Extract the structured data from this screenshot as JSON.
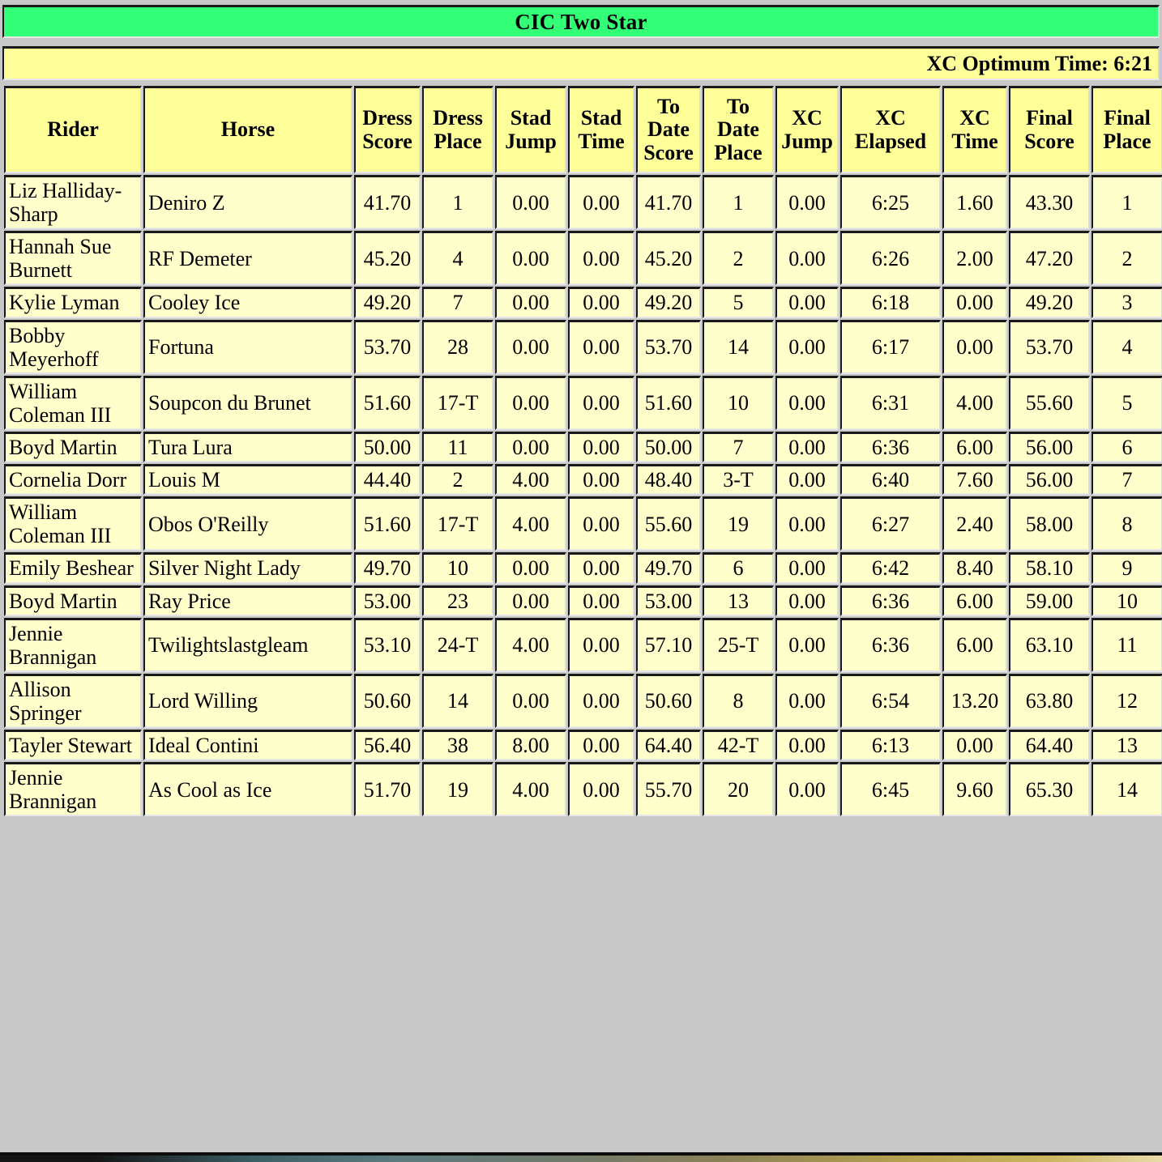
{
  "header": {
    "title": "CIC Two Star",
    "optimum_time_label": "XC Optimum Time: 6:21",
    "colors": {
      "title_bar_bg": "#33FF77",
      "optimum_bar_bg": "#FFFF99",
      "table_header_bg": "#FFFF99",
      "table_cell_bg": "#FFFFCC",
      "border_dark": "#1A1A1A",
      "page_bg": "#C8C8C8"
    }
  },
  "table": {
    "columns": [
      {
        "key": "rider",
        "label": "Rider"
      },
      {
        "key": "horse",
        "label": "Horse"
      },
      {
        "key": "dress_score",
        "label": "Dress Score"
      },
      {
        "key": "dress_place",
        "label": "Dress Place"
      },
      {
        "key": "stad_jump",
        "label": "Stad Jump"
      },
      {
        "key": "stad_time",
        "label": "Stad Time"
      },
      {
        "key": "to_date_score",
        "label": "To Date Score"
      },
      {
        "key": "to_date_place",
        "label": "To Date Place"
      },
      {
        "key": "xc_jump",
        "label": "XC Jump"
      },
      {
        "key": "xc_elapsed",
        "label": "XC Elapsed"
      },
      {
        "key": "xc_time",
        "label": "XC Time"
      },
      {
        "key": "final_score",
        "label": "Final Score"
      },
      {
        "key": "final_place",
        "label": "Final Place"
      }
    ],
    "column_labels_lines": [
      [
        "Rider"
      ],
      [
        "Horse"
      ],
      [
        "Dress",
        "Score"
      ],
      [
        "Dress",
        "Place"
      ],
      [
        "Stad",
        "Jump"
      ],
      [
        "Stad",
        "Time"
      ],
      [
        "To",
        "Date",
        "Score"
      ],
      [
        "To",
        "Date",
        "Place"
      ],
      [
        "XC",
        "Jump"
      ],
      [
        "XC",
        "Elapsed"
      ],
      [
        "XC",
        "Time"
      ],
      [
        "Final",
        "Score"
      ],
      [
        "Final",
        "Place"
      ]
    ],
    "rows": [
      {
        "rider": "Liz Halliday-Sharp",
        "horse": "Deniro Z",
        "dress_score": "41.70",
        "dress_place": "1",
        "stad_jump": "0.00",
        "stad_time": "0.00",
        "to_date_score": "41.70",
        "to_date_place": "1",
        "xc_jump": "0.00",
        "xc_elapsed": "6:25",
        "xc_time": "1.60",
        "final_score": "43.30",
        "final_place": "1"
      },
      {
        "rider": "Hannah Sue Burnett",
        "horse": "RF Demeter",
        "dress_score": "45.20",
        "dress_place": "4",
        "stad_jump": "0.00",
        "stad_time": "0.00",
        "to_date_score": "45.20",
        "to_date_place": "2",
        "xc_jump": "0.00",
        "xc_elapsed": "6:26",
        "xc_time": "2.00",
        "final_score": "47.20",
        "final_place": "2"
      },
      {
        "rider": "Kylie Lyman",
        "horse": "Cooley Ice",
        "dress_score": "49.20",
        "dress_place": "7",
        "stad_jump": "0.00",
        "stad_time": "0.00",
        "to_date_score": "49.20",
        "to_date_place": "5",
        "xc_jump": "0.00",
        "xc_elapsed": "6:18",
        "xc_time": "0.00",
        "final_score": "49.20",
        "final_place": "3"
      },
      {
        "rider": "Bobby Meyerhoff",
        "horse": "Fortuna",
        "dress_score": "53.70",
        "dress_place": "28",
        "stad_jump": "0.00",
        "stad_time": "0.00",
        "to_date_score": "53.70",
        "to_date_place": "14",
        "xc_jump": "0.00",
        "xc_elapsed": "6:17",
        "xc_time": "0.00",
        "final_score": "53.70",
        "final_place": "4"
      },
      {
        "rider": "William Coleman III",
        "horse": "Soupcon du Brunet",
        "dress_score": "51.60",
        "dress_place": "17-T",
        "stad_jump": "0.00",
        "stad_time": "0.00",
        "to_date_score": "51.60",
        "to_date_place": "10",
        "xc_jump": "0.00",
        "xc_elapsed": "6:31",
        "xc_time": "4.00",
        "final_score": "55.60",
        "final_place": "5"
      },
      {
        "rider": "Boyd Martin",
        "horse": "Tura Lura",
        "dress_score": "50.00",
        "dress_place": "11",
        "stad_jump": "0.00",
        "stad_time": "0.00",
        "to_date_score": "50.00",
        "to_date_place": "7",
        "xc_jump": "0.00",
        "xc_elapsed": "6:36",
        "xc_time": "6.00",
        "final_score": "56.00",
        "final_place": "6"
      },
      {
        "rider": "Cornelia Dorr",
        "horse": "Louis M",
        "dress_score": "44.40",
        "dress_place": "2",
        "stad_jump": "4.00",
        "stad_time": "0.00",
        "to_date_score": "48.40",
        "to_date_place": "3-T",
        "xc_jump": "0.00",
        "xc_elapsed": "6:40",
        "xc_time": "7.60",
        "final_score": "56.00",
        "final_place": "7"
      },
      {
        "rider": "William Coleman III",
        "horse": "Obos O'Reilly",
        "dress_score": "51.60",
        "dress_place": "17-T",
        "stad_jump": "4.00",
        "stad_time": "0.00",
        "to_date_score": "55.60",
        "to_date_place": "19",
        "xc_jump": "0.00",
        "xc_elapsed": "6:27",
        "xc_time": "2.40",
        "final_score": "58.00",
        "final_place": "8"
      },
      {
        "rider": "Emily Beshear",
        "horse": "Silver Night Lady",
        "dress_score": "49.70",
        "dress_place": "10",
        "stad_jump": "0.00",
        "stad_time": "0.00",
        "to_date_score": "49.70",
        "to_date_place": "6",
        "xc_jump": "0.00",
        "xc_elapsed": "6:42",
        "xc_time": "8.40",
        "final_score": "58.10",
        "final_place": "9"
      },
      {
        "rider": "Boyd Martin",
        "horse": "Ray Price",
        "dress_score": "53.00",
        "dress_place": "23",
        "stad_jump": "0.00",
        "stad_time": "0.00",
        "to_date_score": "53.00",
        "to_date_place": "13",
        "xc_jump": "0.00",
        "xc_elapsed": "6:36",
        "xc_time": "6.00",
        "final_score": "59.00",
        "final_place": "10"
      },
      {
        "rider": "Jennie Brannigan",
        "horse": "Twilightslastgleam",
        "dress_score": "53.10",
        "dress_place": "24-T",
        "stad_jump": "4.00",
        "stad_time": "0.00",
        "to_date_score": "57.10",
        "to_date_place": "25-T",
        "xc_jump": "0.00",
        "xc_elapsed": "6:36",
        "xc_time": "6.00",
        "final_score": "63.10",
        "final_place": "11"
      },
      {
        "rider": "Allison Springer",
        "horse": "Lord Willing",
        "dress_score": "50.60",
        "dress_place": "14",
        "stad_jump": "0.00",
        "stad_time": "0.00",
        "to_date_score": "50.60",
        "to_date_place": "8",
        "xc_jump": "0.00",
        "xc_elapsed": "6:54",
        "xc_time": "13.20",
        "final_score": "63.80",
        "final_place": "12"
      },
      {
        "rider": "Tayler Stewart",
        "horse": "Ideal Contini",
        "dress_score": "56.40",
        "dress_place": "38",
        "stad_jump": "8.00",
        "stad_time": "0.00",
        "to_date_score": "64.40",
        "to_date_place": "42-T",
        "xc_jump": "0.00",
        "xc_elapsed": "6:13",
        "xc_time": "0.00",
        "final_score": "64.40",
        "final_place": "13"
      },
      {
        "rider": "Jennie Brannigan",
        "horse": "As Cool as Ice",
        "dress_score": "51.70",
        "dress_place": "19",
        "stad_jump": "4.00",
        "stad_time": "0.00",
        "to_date_score": "55.70",
        "to_date_place": "20",
        "xc_jump": "0.00",
        "xc_elapsed": "6:45",
        "xc_time": "9.60",
        "final_score": "65.30",
        "final_place": "14"
      }
    ]
  }
}
